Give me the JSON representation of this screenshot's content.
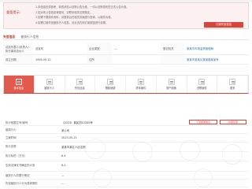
{
  "notice": {
    "title": "重要提示：",
    "lines": [
      "1.本信息仅供参考，标的状态以法院公告为准，一切以法院发布的正式公告为准。",
      "2.如对本公告信息有疑问，请联系相关法院核实。",
      "3.如需下载原件资料，请登录后在相关页面进行查询，以原件为准。",
      "4.如需订阅失信被执行人信息，请点击右侧订阅按钮进行设置。"
    ],
    "button_label": "订阅失信信息"
  },
  "section": {
    "title": "失信信息",
    "subtitle": "被执行人信息"
  },
  "info": {
    "rows": [
      [
        {
          "label": "法定代表人/负责人/执行事务合伙人",
          "value": "法定代"
        },
        {
          "label": "企业类型",
          "value": "—"
        },
        {
          "label": "登记机关",
          "value": "某某市市场监督管理局"
        }
      ],
      [
        {
          "label": "成立日期",
          "value": "1995-05-12"
        },
        {
          "label": "住所",
          "value": ""
        },
        {
          "label": "",
          "value": "某某市某某区某某路某某号"
        }
      ]
    ]
  },
  "tabs": [
    {
      "label": "基本信息",
      "active": true
    },
    {
      "label": "被执行人",
      "active": false
    },
    {
      "label": "失信信息",
      "active": false
    },
    {
      "label": "限制消费",
      "active": false
    },
    {
      "label": "终本案件",
      "active": false
    },
    {
      "label": "财产线索",
      "active": false
    },
    {
      "label": "关联案件",
      "active": false
    },
    {
      "label": "更多",
      "active": false
    }
  ],
  "detail": {
    "head_label": "执行依据文号/案号",
    "head_value": "（2023）某民初12345号",
    "btn_download": "下载失信信息",
    "btn_feedback": "纠错反馈",
    "rows": [
      {
        "label": "被执行人",
        "value": "某公司"
      },
      {
        "label": "立案时间",
        "value": "2023-05-21"
      },
      {
        "label": "执行法院",
        "value": "某某市某区人民法院"
      },
      {
        "label": "执行标的（万元）",
        "value": "6.4"
      },
      {
        "label": "生效法律文书确定的义务",
        "value": "8.2"
      },
      {
        "label": "被执行人的履行情况",
        "value": "—"
      },
      {
        "label": "失信被执行人行为具体情形",
        "value": "—"
      }
    ]
  }
}
